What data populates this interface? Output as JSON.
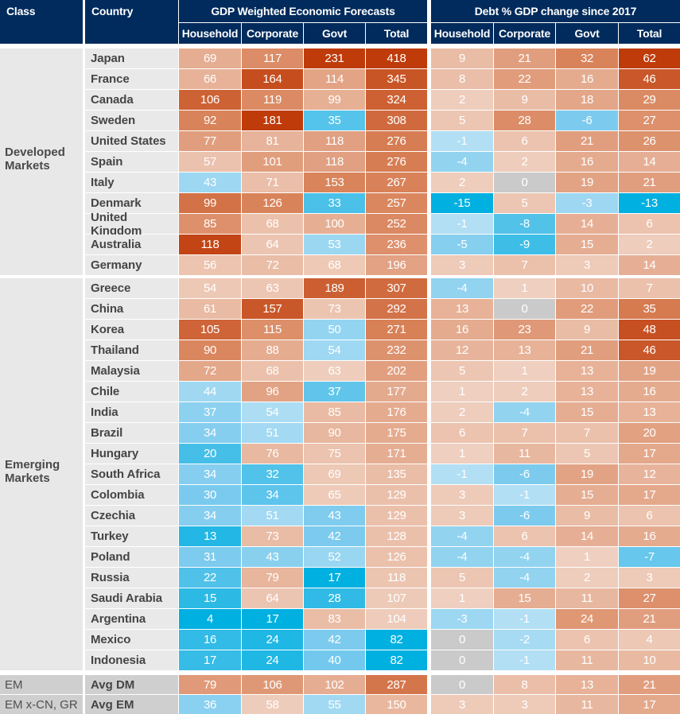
{
  "header": {
    "class": "Class",
    "country": "Country",
    "group1": "GDP Weighted Economic Forecasts",
    "group2": "Debt % GDP change since 2017",
    "sub": [
      "Household",
      "Corporate",
      "Govt",
      "Total",
      "Household",
      "Corporate",
      "Govt",
      "Total"
    ]
  },
  "classes": {
    "developed": "Developed Markets",
    "emerging": "Emerging Markets"
  },
  "colors": {
    "header_bg": "#002b5c",
    "warm_high": "#bf3b0a",
    "warm_low": "#f1d6c8",
    "cool_high": "#00b0e0",
    "cool_low": "#bde3f5",
    "zero": "#cacaca"
  },
  "chart_data": {
    "type": "heatmap",
    "title": "",
    "column_groups": [
      {
        "name": "GDP Weighted Economic Forecasts",
        "columns": [
          "Household",
          "Corporate",
          "Govt",
          "Total"
        ]
      },
      {
        "name": "Debt % GDP change since 2017",
        "columns": [
          "Household",
          "Corporate",
          "Govt",
          "Total"
        ]
      }
    ],
    "rows": [
      {
        "class": "Developed Markets",
        "country": "Japan",
        "values": [
          69,
          117,
          231,
          418,
          9,
          21,
          32,
          62
        ]
      },
      {
        "class": "Developed Markets",
        "country": "France",
        "values": [
          66,
          164,
          114,
          345,
          8,
          22,
          16,
          46
        ]
      },
      {
        "class": "Developed Markets",
        "country": "Canada",
        "values": [
          106,
          119,
          99,
          324,
          2,
          9,
          18,
          29
        ]
      },
      {
        "class": "Developed Markets",
        "country": "Sweden",
        "values": [
          92,
          181,
          35,
          308,
          5,
          28,
          -6,
          27
        ]
      },
      {
        "class": "Developed Markets",
        "country": "United States",
        "values": [
          77,
          81,
          118,
          276,
          -1,
          6,
          21,
          26
        ]
      },
      {
        "class": "Developed Markets",
        "country": "Spain",
        "values": [
          57,
          101,
          118,
          276,
          -4,
          2,
          16,
          14
        ]
      },
      {
        "class": "Developed Markets",
        "country": "Italy",
        "values": [
          43,
          71,
          153,
          267,
          2,
          0,
          19,
          21
        ]
      },
      {
        "class": "Developed Markets",
        "country": "Denmark",
        "values": [
          99,
          126,
          33,
          257,
          -15,
          5,
          -3,
          -13
        ]
      },
      {
        "class": "Developed Markets",
        "country": "United Kingdom",
        "values": [
          85,
          68,
          100,
          252,
          -1,
          -8,
          14,
          6
        ]
      },
      {
        "class": "Developed Markets",
        "country": "Australia",
        "values": [
          118,
          64,
          53,
          236,
          -5,
          -9,
          15,
          2
        ]
      },
      {
        "class": "Developed Markets",
        "country": "Germany",
        "values": [
          56,
          72,
          68,
          196,
          3,
          7,
          3,
          14
        ]
      },
      {
        "class": "Emerging Markets",
        "country": "Greece",
        "values": [
          54,
          63,
          189,
          307,
          -4,
          1,
          10,
          7
        ]
      },
      {
        "class": "Emerging Markets",
        "country": "China",
        "values": [
          61,
          157,
          73,
          292,
          13,
          0,
          22,
          35
        ]
      },
      {
        "class": "Emerging Markets",
        "country": "Korea",
        "values": [
          105,
          115,
          50,
          271,
          16,
          23,
          9,
          48
        ]
      },
      {
        "class": "Emerging Markets",
        "country": "Thailand",
        "values": [
          90,
          88,
          54,
          232,
          12,
          13,
          21,
          46
        ]
      },
      {
        "class": "Emerging Markets",
        "country": "Malaysia",
        "values": [
          72,
          68,
          63,
          202,
          5,
          1,
          13,
          19
        ]
      },
      {
        "class": "Emerging Markets",
        "country": "Chile",
        "values": [
          44,
          96,
          37,
          177,
          1,
          2,
          13,
          16
        ]
      },
      {
        "class": "Emerging Markets",
        "country": "India",
        "values": [
          37,
          54,
          85,
          176,
          2,
          -4,
          15,
          13
        ]
      },
      {
        "class": "Emerging Markets",
        "country": "Brazil",
        "values": [
          34,
          51,
          90,
          175,
          6,
          7,
          7,
          20
        ]
      },
      {
        "class": "Emerging Markets",
        "country": "Hungary",
        "values": [
          20,
          76,
          75,
          171,
          1,
          11,
          5,
          17
        ]
      },
      {
        "class": "Emerging Markets",
        "country": "South Africa",
        "values": [
          34,
          32,
          69,
          135,
          -1,
          -6,
          19,
          12
        ]
      },
      {
        "class": "Emerging Markets",
        "country": "Colombia",
        "values": [
          30,
          34,
          65,
          129,
          3,
          -1,
          15,
          17
        ]
      },
      {
        "class": "Emerging Markets",
        "country": "Czechia",
        "values": [
          34,
          51,
          43,
          129,
          3,
          -6,
          9,
          6
        ]
      },
      {
        "class": "Emerging Markets",
        "country": "Turkey",
        "values": [
          13,
          73,
          42,
          128,
          -4,
          6,
          14,
          16
        ]
      },
      {
        "class": "Emerging Markets",
        "country": "Poland",
        "values": [
          31,
          43,
          52,
          126,
          -4,
          -4,
          1,
          -7
        ]
      },
      {
        "class": "Emerging Markets",
        "country": "Russia",
        "values": [
          22,
          79,
          17,
          118,
          5,
          -4,
          2,
          3
        ]
      },
      {
        "class": "Emerging Markets",
        "country": "Saudi Arabia",
        "values": [
          15,
          64,
          28,
          107,
          1,
          15,
          11,
          27
        ]
      },
      {
        "class": "Emerging Markets",
        "country": "Argentina",
        "values": [
          4,
          17,
          83,
          104,
          -3,
          -1,
          24,
          21
        ]
      },
      {
        "class": "Emerging Markets",
        "country": "Mexico",
        "values": [
          16,
          24,
          42,
          82,
          0,
          -2,
          6,
          4
        ]
      },
      {
        "class": "Emerging Markets",
        "country": "Indonesia",
        "values": [
          17,
          24,
          40,
          82,
          0,
          -1,
          11,
          10
        ]
      }
    ],
    "summary_rows": [
      {
        "class": "EM",
        "country": "Avg DM",
        "values": [
          79,
          106,
          102,
          287,
          0,
          8,
          13,
          21
        ]
      },
      {
        "class": "EM x-CN, GR",
        "country": "Avg EM",
        "values": [
          36,
          58,
          55,
          150,
          3,
          3,
          11,
          17
        ]
      }
    ],
    "color_scale": {
      "gdp_weighted": {
        "Household": [
          4,
          118
        ],
        "Corporate": [
          17,
          181
        ],
        "Govt": [
          17,
          231
        ],
        "Total": [
          82,
          418
        ]
      },
      "debt_change": "diverging around 0: blue for negative, orange for positive, grey for zero"
    }
  }
}
